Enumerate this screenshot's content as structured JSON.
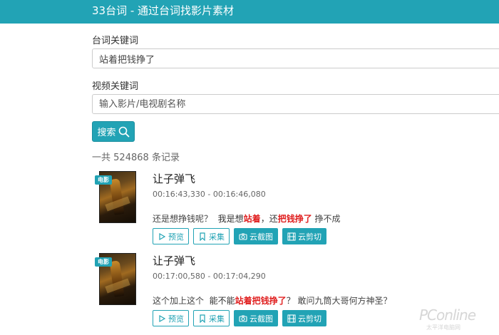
{
  "header": {
    "title": "33台词 - 通过台词找影片素材"
  },
  "form": {
    "line_label": "台词关键词",
    "line_value": "站着把钱挣了",
    "video_label": "视频关键词",
    "video_placeholder": "输入影片/电视剧名称",
    "search_label": "搜索"
  },
  "summary": {
    "prefix": "一共",
    "count": "524868",
    "suffix": "条记录"
  },
  "results": [
    {
      "badge": "电影",
      "title": "让子弹飞",
      "time": "00:16:43,330 - 00:16:46,080",
      "pre": "还是想挣钱呢？",
      "mid1": "我是想",
      "hl1": "站着",
      "mid2": "，还",
      "hl2": "把钱挣了",
      "post": "挣不成"
    },
    {
      "badge": "电影",
      "title": "让子弹飞",
      "time": "00:17:00,580 - 00:17:04,290",
      "pre": "这个加上这个",
      "mid1": "能不能",
      "hl1": "站着把钱挣了",
      "mid2": "？",
      "hl2": "",
      "post": "敢问九筒大哥何方神圣？"
    }
  ],
  "actions": {
    "preview": "预览",
    "collect": "采集",
    "screenshot": "云截图",
    "clip": "云剪切"
  },
  "watermark": {
    "main": "PConline",
    "sub": "太平洋电脑网"
  },
  "colors": {
    "accent": "#22a3b5",
    "highlight": "#e02020"
  }
}
